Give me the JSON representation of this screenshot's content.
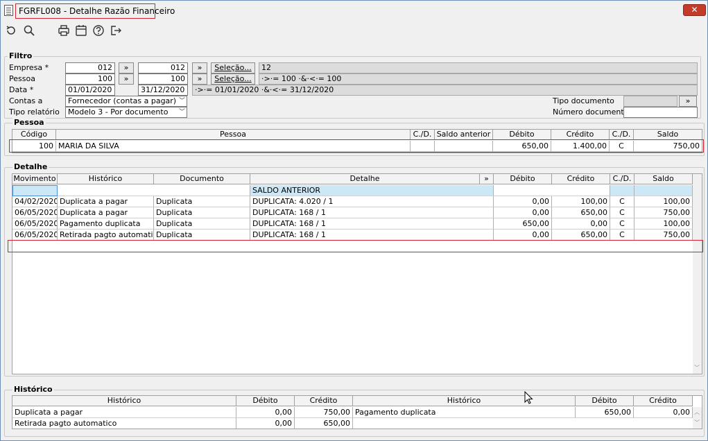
{
  "window": {
    "title": "FGRFL008 - Detalhe Razão Financeiro",
    "close_label": "✕"
  },
  "toolbar": {
    "icons": [
      "refresh-icon",
      "search-icon",
      "print-icon",
      "calendar-icon",
      "help-icon",
      "exit-icon"
    ]
  },
  "filtro": {
    "title": "Filtro",
    "empresa_label": "Empresa *",
    "empresa_from": "012",
    "empresa_to": "012",
    "empresa_summary": "12",
    "pessoa_label": "Pessoa",
    "pessoa_from": "100",
    "pessoa_to": "100",
    "pessoa_summary": "·>·= 100 ·&·<·= 100",
    "data_label": "Data *",
    "data_from": "01/01/2020",
    "data_to": "31/12/2020",
    "data_summary": "·>·= 01/01/2020 ·&·<·= 31/12/2020",
    "contas_label": "Contas a",
    "contas_value": "Fornecedor (contas a pagar)",
    "tipo_relatorio_label": "Tipo relatório",
    "tipo_relatorio_value": "Modelo 3 - Por documento",
    "tipo_documento_label": "Tipo documento",
    "numero_documento_label": "Número documento",
    "arrow_label": "»",
    "selecao_label": "Seleção..."
  },
  "pessoa": {
    "title": "Pessoa",
    "headers": [
      "Código",
      "Pessoa",
      "C./D.",
      "Saldo anterior",
      "Débito",
      "Crédito",
      "C./D.",
      "Saldo"
    ],
    "row": [
      "100",
      "MARIA DA SILVA",
      "",
      "",
      "650,00",
      "1.400,00",
      "C",
      "750,00"
    ]
  },
  "detalhe": {
    "title": "Detalhe",
    "headers": [
      "Movimento",
      "Histórico",
      "Documento",
      "Detalhe",
      "»",
      "Débito",
      "Crédito",
      "C./D.",
      "Saldo"
    ],
    "saldo_anterior": "SALDO ANTERIOR",
    "rows": [
      [
        "04/02/2020",
        "Duplicata a pagar",
        "Duplicata",
        "DUPLICATA: 4.020 / 1",
        "0,00",
        "100,00",
        "C",
        "100,00"
      ],
      [
        "06/05/2020",
        "Duplicata a pagar",
        "Duplicata",
        "DUPLICATA: 168 / 1",
        "0,00",
        "650,00",
        "C",
        "750,00"
      ],
      [
        "06/05/2020",
        "Pagamento duplicata",
        "Duplicata",
        "DUPLICATA: 168 / 1",
        "650,00",
        "0,00",
        "C",
        "100,00"
      ],
      [
        "06/05/2020",
        "Retirada pagto automatico",
        "Duplicata",
        "DUPLICATA: 168 / 1",
        "0,00",
        "650,00",
        "C",
        "750,00"
      ]
    ]
  },
  "historico": {
    "title": "Histórico",
    "headers": [
      "Histórico",
      "Débito",
      "Crédito",
      "Histórico",
      "Débito",
      "Crédito"
    ],
    "left_rows": [
      [
        "Duplicata a pagar",
        "0,00",
        "750,00"
      ],
      [
        "Retirada pagto automatico",
        "0,00",
        "650,00"
      ]
    ],
    "right_rows": [
      [
        "Pagamento duplicata",
        "650,00",
        "0,00"
      ]
    ]
  },
  "colors": {
    "highlight_border": "#d9202f",
    "selected_row": "#cce8f6",
    "close_button": "#c43b2a"
  }
}
